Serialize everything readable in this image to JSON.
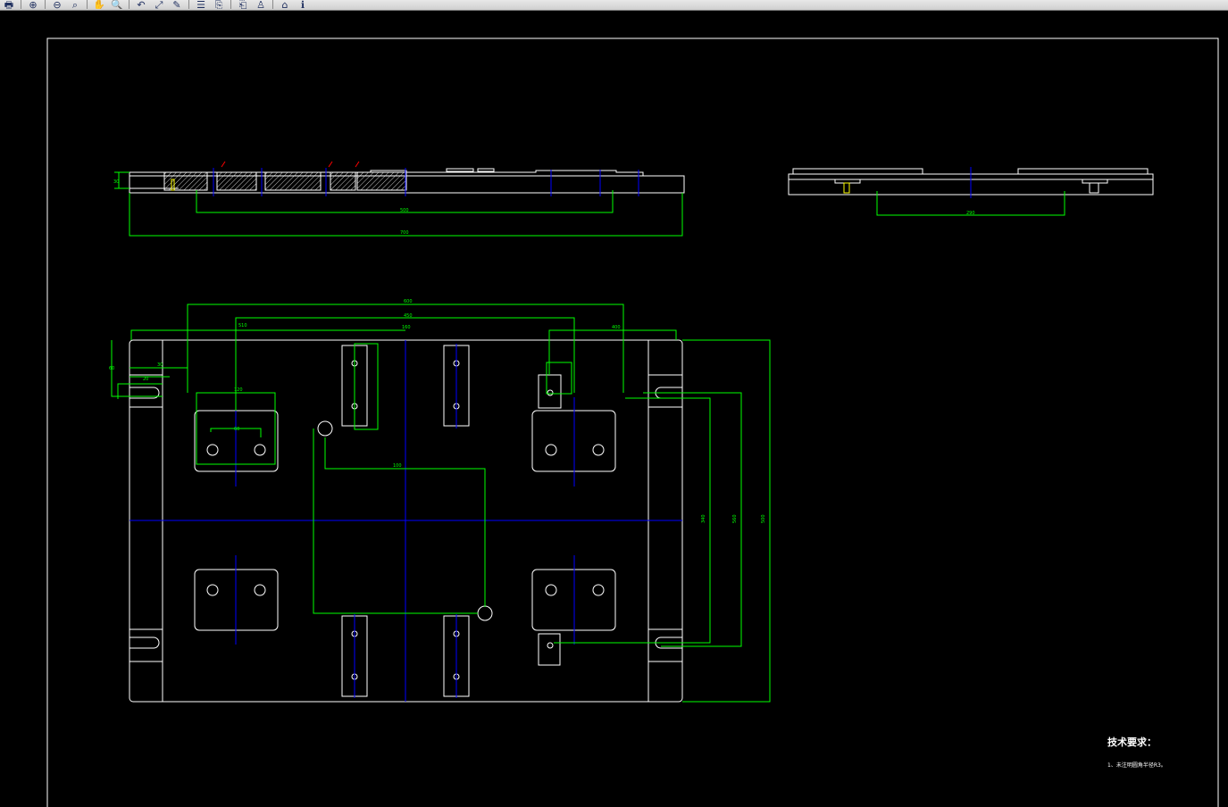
{
  "toolbar": {
    "buttons": [
      {
        "name": "print-icon",
        "glyph": "🖶"
      },
      {
        "name": "zoom-in-icon",
        "glyph": "⊕"
      },
      {
        "name": "zoom-out-icon",
        "glyph": "⊖"
      },
      {
        "name": "zoom-window-icon",
        "glyph": "⌕"
      },
      {
        "name": "pan-icon",
        "glyph": "✋"
      },
      {
        "name": "zoom-realtime-icon",
        "glyph": "🔍"
      },
      {
        "name": "zoom-previous-icon",
        "glyph": "↶"
      },
      {
        "name": "zoom-extents-icon",
        "glyph": "⤢"
      },
      {
        "name": "properties-icon",
        "glyph": "✎"
      },
      {
        "name": "layers-icon",
        "glyph": "☰"
      },
      {
        "name": "copy-icon",
        "glyph": "⎘"
      },
      {
        "name": "paste-icon",
        "glyph": "⎗"
      },
      {
        "name": "user-icon",
        "glyph": "♙"
      },
      {
        "name": "home-icon",
        "glyph": "⌂"
      },
      {
        "name": "info-icon",
        "glyph": "ℹ"
      }
    ]
  },
  "colors": {
    "background": "#000000",
    "outline": "#ffffff",
    "dimension": "#00ff00",
    "centerline": "#0000ff",
    "hatch": "#ffffff",
    "highlight": "#ffff00",
    "annotation_red": "#ff0000"
  },
  "drawing": {
    "tech_requirements_title": "技术要求：",
    "tech_requirements_item": "1、未注明圆角半径R3。",
    "side_view_dims": [
      "500",
      "700",
      "30"
    ],
    "end_view_dims": [
      "290"
    ],
    "plan_view_dims": [
      "600",
      "450",
      "160",
      "400",
      "510",
      "120",
      "60",
      "30",
      "500",
      "560",
      "340",
      "100",
      "60",
      "20"
    ]
  }
}
